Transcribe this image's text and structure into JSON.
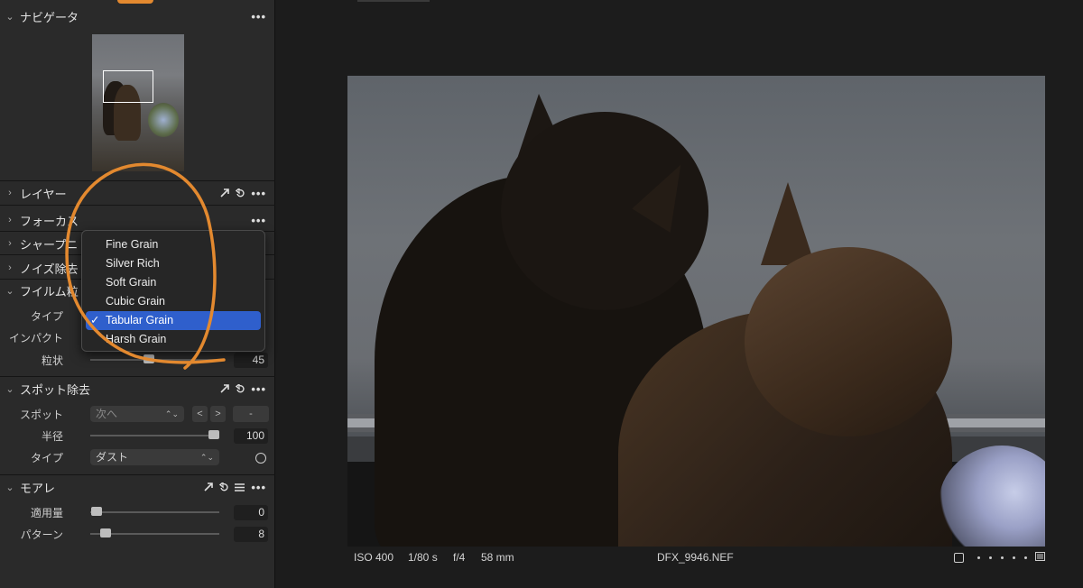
{
  "sidebar": {
    "navigator": {
      "title": "ナビゲータ",
      "more": "•••"
    },
    "layer": {
      "title": "レイヤー",
      "more": "•••"
    },
    "focus": {
      "title": "フォーカス",
      "more": "•••"
    },
    "sharpening": {
      "title": "シャープニ",
      "more": "•••"
    },
    "noise": {
      "title": "ノイズ除去",
      "more": "•••"
    },
    "film_grain": {
      "title": "フイルム粒",
      "more": "•••",
      "type_label": "タイプ",
      "impact_label": "インパクト",
      "grain_label": "粒状",
      "grain_value": "45",
      "grain_level": 0.45
    },
    "spot_removal": {
      "title": "スポット除去",
      "more": "•••",
      "spot_label": "スポット",
      "spot_select": "次へ",
      "prev_btn": "<",
      "next_btn": ">",
      "minus_btn": "-",
      "radius_label": "半径",
      "radius_value": "100",
      "radius_level": 1.0,
      "type_label": "タイプ",
      "type_select": "ダスト"
    },
    "moire": {
      "title": "モアレ",
      "amount_label": "適用量",
      "amount_value": "0",
      "amount_level": 0.0,
      "pattern_label": "パターン",
      "pattern_value": "8",
      "pattern_level": 0.08
    }
  },
  "grain_menu": {
    "items": [
      "Fine Grain",
      "Silver Rich",
      "Soft Grain",
      "Cubic Grain",
      "Tabular Grain",
      "Harsh Grain"
    ],
    "selected": "Tabular Grain",
    "check": "✓"
  },
  "infobar": {
    "iso": "ISO 400",
    "shutter": "1/80 s",
    "aperture": "f/4",
    "focal": "58 mm",
    "filename": "DFX_9946.NEF"
  },
  "colors": {
    "accent": "#2f5fcc",
    "annotation": "#e3892f"
  }
}
